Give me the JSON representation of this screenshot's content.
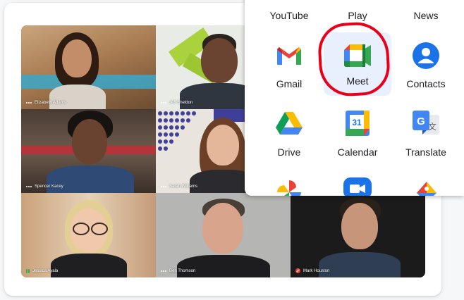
{
  "participants": [
    {
      "name": "Elizabeth Adams"
    },
    {
      "name": "Jeff Sheldon"
    },
    {
      "name": "Spencer Kacey"
    },
    {
      "name": "Sarah Williams"
    },
    {
      "name": "Jessica Ayala"
    },
    {
      "name": "Ben Thomson"
    },
    {
      "name": "Mark Houston"
    }
  ],
  "launcher": {
    "row1": [
      "YouTube",
      "Play",
      "News"
    ],
    "row2": [
      "Gmail",
      "Meet",
      "Contacts"
    ],
    "row3": [
      "Drive",
      "Calendar",
      "Translate"
    ],
    "calendar_day": "31",
    "translate_glyph_g": "G",
    "translate_glyph_wen": "文",
    "selected": "Meet"
  },
  "colors": {
    "annotation": "#e8001a",
    "selected_bg": "#e8f0fe",
    "google_blue": "#4285f4",
    "google_red": "#ea4335",
    "google_yellow": "#fbbc04",
    "google_green": "#34a853"
  }
}
